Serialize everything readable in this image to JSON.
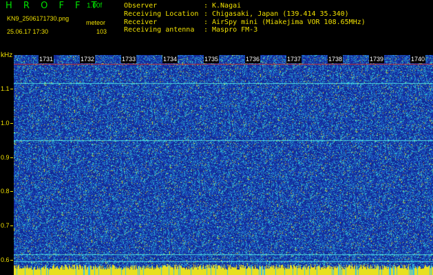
{
  "header": {
    "app_title": "H R O F F T",
    "version": "1.00f",
    "filename": "KN9_2506171730.png",
    "datetime": "25.06.17 17:30",
    "meteor_label": "meteor",
    "meteor_count": "103"
  },
  "info": [
    {
      "key": "Observer",
      "value": "K.Nagai"
    },
    {
      "key": "Receiving Location",
      "value": "Chigasaki, Japan (139.414 35.340)"
    },
    {
      "key": "Receiver",
      "value": "AirSpy mini (Miakejima VOR 108.65MHz)"
    },
    {
      "key": "Receiving antenna",
      "value": "Maspro FM-3"
    }
  ],
  "axis": {
    "unit": "kHz",
    "y_ticks": [
      "1.1",
      "1.0",
      "0.9",
      "0.8",
      "0.7",
      "0.6"
    ],
    "time_labels": [
      "1731",
      "1732",
      "1733",
      "1734",
      "1735",
      "1736",
      "1737",
      "1738",
      "1739",
      "1740"
    ]
  },
  "colors": {
    "background": "#000000",
    "text_yellow": "#f0e000",
    "title_green": "#00e000",
    "spectrum_base": "#1a3fb0",
    "noise_cyan": "#2ad8e8",
    "noise_yellow": "#e8e020"
  }
}
